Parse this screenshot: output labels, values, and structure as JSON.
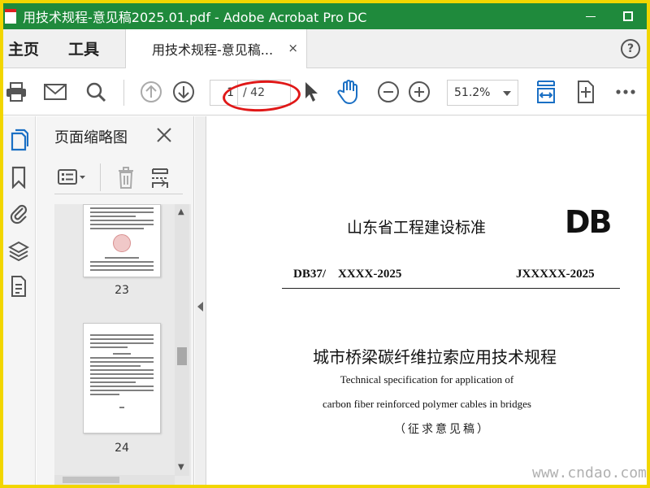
{
  "window": {
    "title": "用技术规程-意见稿2025.01.pdf - Adobe Acrobat Pro DC"
  },
  "menu": {
    "home": "主页",
    "tools": "工具"
  },
  "tab": {
    "label": "用技术规程-意见稿...",
    "close": "×"
  },
  "help": {
    "label": "?"
  },
  "toolbar": {
    "current_page": "1",
    "total_pages": "/ 42",
    "zoom": "51.2%"
  },
  "panel": {
    "title": "页面缩略图",
    "thumbnails": [
      {
        "page": "23"
      },
      {
        "page": "24"
      }
    ]
  },
  "document": {
    "org": "山东省工程建设标准",
    "logo": "DB",
    "code_left": "DB37/    XXXX-2025",
    "code_right": "JXXXXX-2025",
    "title_cn": "城市桥梁碳纤维拉索应用技术规程",
    "title_en_1": "Technical specification for application of",
    "title_en_2": "carbon fiber reinforced polymer cables in bridges",
    "status": "（征求意见稿）"
  },
  "watermark": "www.cndao.com",
  "colors": {
    "titlebar": "#1f8a3c",
    "frame": "#f2d600",
    "accent_blue": "#1a6fc4",
    "annotation_red": "#e01818"
  }
}
